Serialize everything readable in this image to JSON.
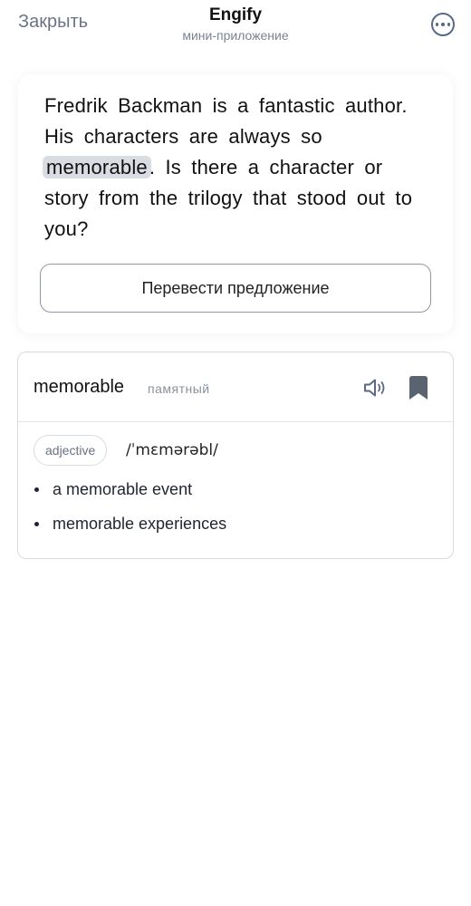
{
  "header": {
    "close_label": "Закрыть",
    "title": "Engify",
    "subtitle": "мини-приложение",
    "more_icon": "more-horizontal-icon"
  },
  "sentence": {
    "before": "Fredrik Backman is a fantastic author. His characters are always so ",
    "highlight": "memorable",
    "after": ". Is there a character or story from the trilogy that stood out to you?",
    "translate_button": "Перевести предложение"
  },
  "word_card": {
    "word": "memorable",
    "translation": "памятный",
    "part_of_speech": "adjective",
    "transcription": "/ˈmɛmərəbl/",
    "examples": [
      "a memorable event",
      "memorable experiences"
    ],
    "speaker_icon": "speaker-icon",
    "bookmark_icon": "bookmark-icon"
  },
  "colors": {
    "highlight_bg": "#d9dde3",
    "muted_text": "#6a7486",
    "icon_color": "#5a6a86"
  }
}
